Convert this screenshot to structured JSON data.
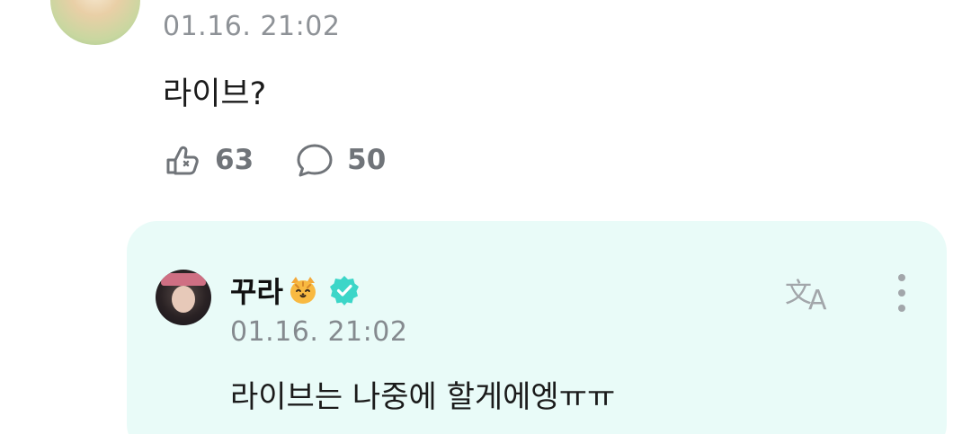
{
  "top_comment": {
    "timestamp": "01.16. 21:02",
    "body": "라이브?",
    "like_count": "63",
    "reply_count": "50"
  },
  "reply": {
    "author": "꾸라",
    "timestamp": "01.16. 21:02",
    "body": "라이브는 나중에 할게에엥ㅠㅠ"
  },
  "icons": {
    "like": "like-icon",
    "comment": "comment-bubble-icon",
    "translate": "translate-icon",
    "more": "more-vertical-icon",
    "verified": "verified-badge-icon",
    "emoji": "cat-emoji"
  },
  "colors": {
    "reply_background": "#e9fbf8",
    "accent_mint": "#3cd6c8",
    "muted_text": "#8e9297"
  }
}
